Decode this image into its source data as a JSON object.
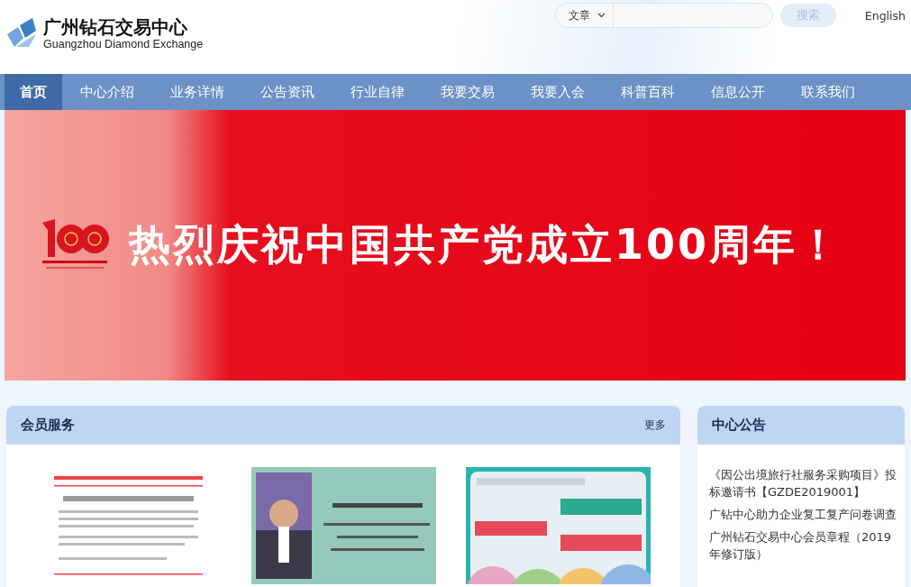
{
  "header": {
    "logo_name": "广州钻石交易中心",
    "logo_subtitle": "Guangzhou Diamond Exchange",
    "search": {
      "scope": "文章",
      "button": "搜索"
    },
    "language": "English"
  },
  "nav": [
    {
      "label": "首页",
      "selected": true
    },
    {
      "label": "中心介绍",
      "selected": false
    },
    {
      "label": "业务详情",
      "selected": false
    },
    {
      "label": "公告资讯",
      "selected": false
    },
    {
      "label": "行业自律",
      "selected": false
    },
    {
      "label": "我要交易",
      "selected": false
    },
    {
      "label": "我要入会",
      "selected": false
    },
    {
      "label": "科普百科",
      "selected": false
    },
    {
      "label": "信息公开",
      "selected": false
    },
    {
      "label": "联系我们",
      "selected": false
    }
  ],
  "banner": {
    "headline": "热烈庆祝中国共产党成立100周年！"
  },
  "member_services": {
    "title": "会员服务",
    "more": "更多"
  },
  "announcements": {
    "title": "中心公告",
    "items": [
      "《因公出境旅行社服务采购项目》投标邀请书【GZDE2019001】",
      "广钻中心助力企业复工复产问卷调查",
      "广州钻石交易中心会员章程（2019年修订版）"
    ]
  }
}
